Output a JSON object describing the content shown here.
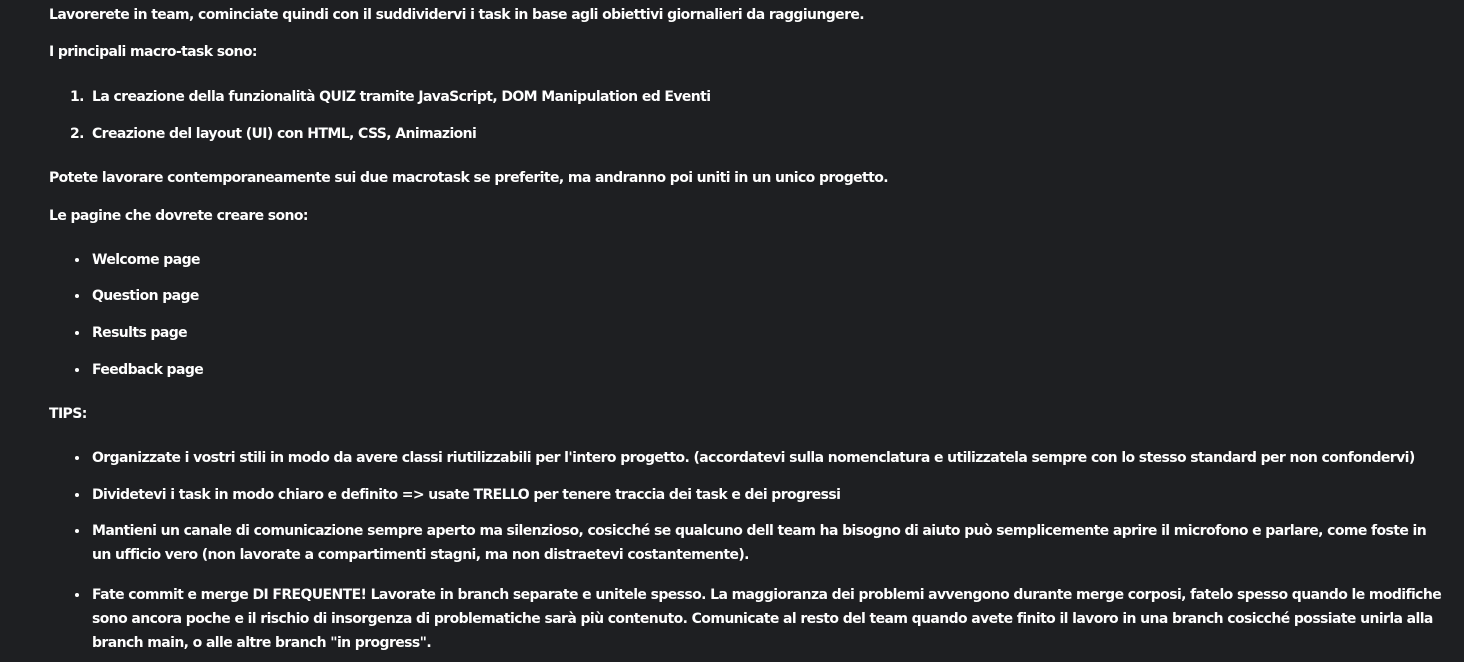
{
  "intro": "Lavorerete in team, cominciate quindi con il suddividervi i task in base agli obiettivi giornalieri da raggiungere.",
  "macro_heading": "I principali macro-task sono:",
  "macro_tasks": [
    {
      "num": "1.",
      "text": "La creazione della funzionalità QUIZ tramite JavaScript, DOM Manipulation ed Eventi"
    },
    {
      "num": "2.",
      "text": "Creazione del layout  (UI) con HTML, CSS, Animazioni"
    }
  ],
  "parallel_note": "Potete lavorare contemporaneamente sui due macrotask se preferite, ma andranno poi uniti in un unico progetto.",
  "pages_heading": "Le pagine che dovrete creare sono:",
  "pages": [
    "Welcome page",
    "Question page",
    "Results page",
    "Feedback page"
  ],
  "tips_heading": "TIPS:",
  "tips": [
    "Organizzate i vostri stili in modo da avere classi riutilizzabili per l'intero progetto. (accordatevi sulla nomenclatura e utilizzatela sempre con lo stesso standard per non confondervi)",
    "Dividetevi i task in modo chiaro e definito => usate TRELLO per tenere traccia dei task e dei progressi",
    "Mantieni un canale di comunicazione sempre aperto ma silenzioso, cosicché se qualcuno dell team ha bisogno di aiuto può semplicemente aprire il microfono e parlare, come foste in un ufficio vero (non lavorate a compartimenti stagni, ma non distraetevi costantemente).",
    "Fate commit e merge DI FREQUENTE! Lavorate in branch separate e unitele spesso. La maggioranza dei problemi avvengono durante merge corposi, fatelo spesso quando le modifiche sono ancora poche e il rischio di insorgenza di problematiche sarà più contenuto. Comunicate al resto del team quando avete finito il lavoro in una branch cosicché possiate unirla alla branch main, o alle altre branch \"in progress\"."
  ]
}
